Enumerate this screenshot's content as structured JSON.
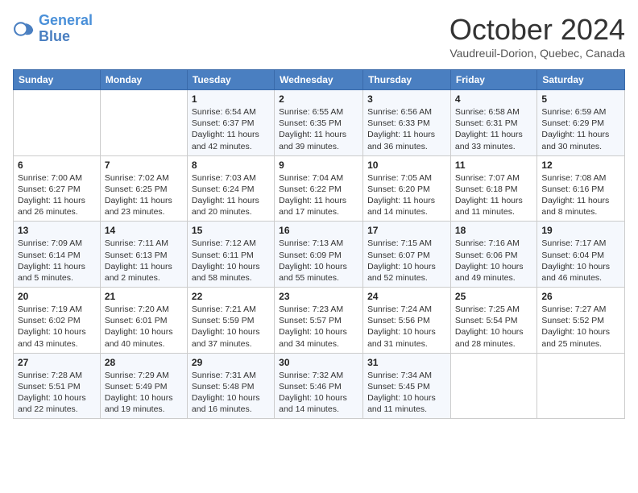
{
  "logo": {
    "line1": "General",
    "line2": "Blue"
  },
  "title": "October 2024",
  "subtitle": "Vaudreuil-Dorion, Quebec, Canada",
  "days_header": [
    "Sunday",
    "Monday",
    "Tuesday",
    "Wednesday",
    "Thursday",
    "Friday",
    "Saturday"
  ],
  "weeks": [
    [
      {
        "day": "",
        "info": ""
      },
      {
        "day": "",
        "info": ""
      },
      {
        "day": "1",
        "info": "Sunrise: 6:54 AM\nSunset: 6:37 PM\nDaylight: 11 hours and 42 minutes."
      },
      {
        "day": "2",
        "info": "Sunrise: 6:55 AM\nSunset: 6:35 PM\nDaylight: 11 hours and 39 minutes."
      },
      {
        "day": "3",
        "info": "Sunrise: 6:56 AM\nSunset: 6:33 PM\nDaylight: 11 hours and 36 minutes."
      },
      {
        "day": "4",
        "info": "Sunrise: 6:58 AM\nSunset: 6:31 PM\nDaylight: 11 hours and 33 minutes."
      },
      {
        "day": "5",
        "info": "Sunrise: 6:59 AM\nSunset: 6:29 PM\nDaylight: 11 hours and 30 minutes."
      }
    ],
    [
      {
        "day": "6",
        "info": "Sunrise: 7:00 AM\nSunset: 6:27 PM\nDaylight: 11 hours and 26 minutes."
      },
      {
        "day": "7",
        "info": "Sunrise: 7:02 AM\nSunset: 6:25 PM\nDaylight: 11 hours and 23 minutes."
      },
      {
        "day": "8",
        "info": "Sunrise: 7:03 AM\nSunset: 6:24 PM\nDaylight: 11 hours and 20 minutes."
      },
      {
        "day": "9",
        "info": "Sunrise: 7:04 AM\nSunset: 6:22 PM\nDaylight: 11 hours and 17 minutes."
      },
      {
        "day": "10",
        "info": "Sunrise: 7:05 AM\nSunset: 6:20 PM\nDaylight: 11 hours and 14 minutes."
      },
      {
        "day": "11",
        "info": "Sunrise: 7:07 AM\nSunset: 6:18 PM\nDaylight: 11 hours and 11 minutes."
      },
      {
        "day": "12",
        "info": "Sunrise: 7:08 AM\nSunset: 6:16 PM\nDaylight: 11 hours and 8 minutes."
      }
    ],
    [
      {
        "day": "13",
        "info": "Sunrise: 7:09 AM\nSunset: 6:14 PM\nDaylight: 11 hours and 5 minutes."
      },
      {
        "day": "14",
        "info": "Sunrise: 7:11 AM\nSunset: 6:13 PM\nDaylight: 11 hours and 2 minutes."
      },
      {
        "day": "15",
        "info": "Sunrise: 7:12 AM\nSunset: 6:11 PM\nDaylight: 10 hours and 58 minutes."
      },
      {
        "day": "16",
        "info": "Sunrise: 7:13 AM\nSunset: 6:09 PM\nDaylight: 10 hours and 55 minutes."
      },
      {
        "day": "17",
        "info": "Sunrise: 7:15 AM\nSunset: 6:07 PM\nDaylight: 10 hours and 52 minutes."
      },
      {
        "day": "18",
        "info": "Sunrise: 7:16 AM\nSunset: 6:06 PM\nDaylight: 10 hours and 49 minutes."
      },
      {
        "day": "19",
        "info": "Sunrise: 7:17 AM\nSunset: 6:04 PM\nDaylight: 10 hours and 46 minutes."
      }
    ],
    [
      {
        "day": "20",
        "info": "Sunrise: 7:19 AM\nSunset: 6:02 PM\nDaylight: 10 hours and 43 minutes."
      },
      {
        "day": "21",
        "info": "Sunrise: 7:20 AM\nSunset: 6:01 PM\nDaylight: 10 hours and 40 minutes."
      },
      {
        "day": "22",
        "info": "Sunrise: 7:21 AM\nSunset: 5:59 PM\nDaylight: 10 hours and 37 minutes."
      },
      {
        "day": "23",
        "info": "Sunrise: 7:23 AM\nSunset: 5:57 PM\nDaylight: 10 hours and 34 minutes."
      },
      {
        "day": "24",
        "info": "Sunrise: 7:24 AM\nSunset: 5:56 PM\nDaylight: 10 hours and 31 minutes."
      },
      {
        "day": "25",
        "info": "Sunrise: 7:25 AM\nSunset: 5:54 PM\nDaylight: 10 hours and 28 minutes."
      },
      {
        "day": "26",
        "info": "Sunrise: 7:27 AM\nSunset: 5:52 PM\nDaylight: 10 hours and 25 minutes."
      }
    ],
    [
      {
        "day": "27",
        "info": "Sunrise: 7:28 AM\nSunset: 5:51 PM\nDaylight: 10 hours and 22 minutes."
      },
      {
        "day": "28",
        "info": "Sunrise: 7:29 AM\nSunset: 5:49 PM\nDaylight: 10 hours and 19 minutes."
      },
      {
        "day": "29",
        "info": "Sunrise: 7:31 AM\nSunset: 5:48 PM\nDaylight: 10 hours and 16 minutes."
      },
      {
        "day": "30",
        "info": "Sunrise: 7:32 AM\nSunset: 5:46 PM\nDaylight: 10 hours and 14 minutes."
      },
      {
        "day": "31",
        "info": "Sunrise: 7:34 AM\nSunset: 5:45 PM\nDaylight: 10 hours and 11 minutes."
      },
      {
        "day": "",
        "info": ""
      },
      {
        "day": "",
        "info": ""
      }
    ]
  ]
}
